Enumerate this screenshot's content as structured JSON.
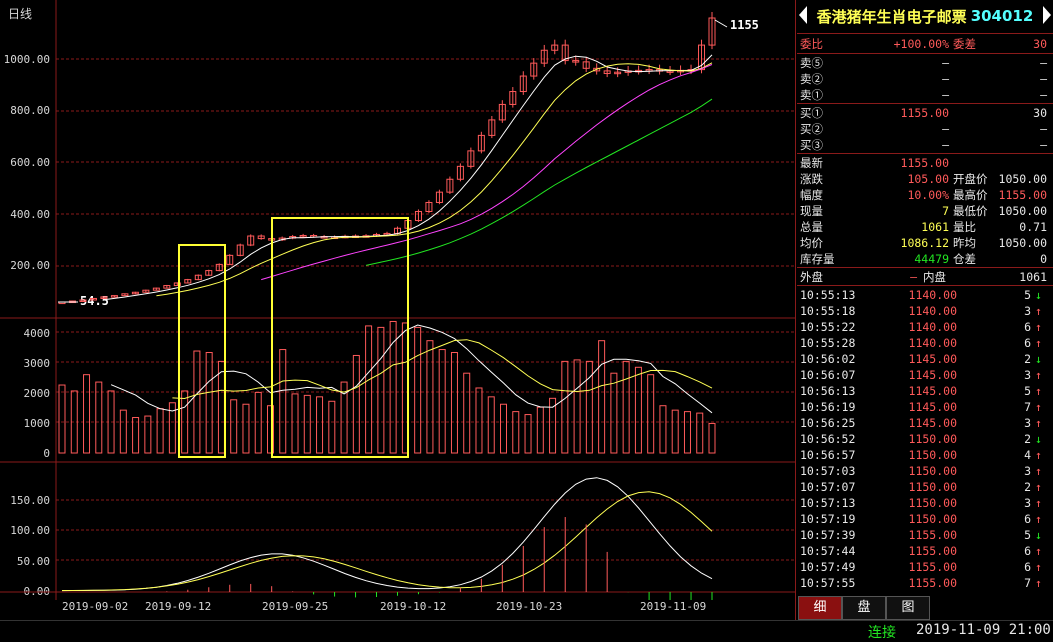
{
  "chart": {
    "period_label": "日线",
    "price_ticks": [
      "1000.00",
      "800.00",
      "600.00",
      "400.00",
      "200.00"
    ],
    "volume_ticks": [
      "4000",
      "3000",
      "2000",
      "1000",
      "0"
    ],
    "indicator_ticks": [
      "150.00",
      "100.00",
      "50.00",
      "0.00"
    ],
    "date_ticks": [
      "2019-09-02",
      "2019-09-12",
      "2019-09-25",
      "2019-10-12",
      "2019-10-23",
      "2019-11-09"
    ],
    "high_label": "1155",
    "low_label": "54.5",
    "colors": {
      "up": "#ff5a5a",
      "ma1": "#ffffff",
      "ma2": "#ffff55",
      "ma3": "#ff44ff",
      "ma4": "#22e622",
      "box": "#ffff33",
      "grid": "#8a1a1a"
    }
  },
  "chart_data": {
    "type": "candlestick",
    "dates": [
      "2019-09-02",
      "2019-09-12",
      "2019-09-25",
      "2019-10-12",
      "2019-10-23",
      "2019-11-09"
    ],
    "close": [
      54,
      58,
      62,
      68,
      74,
      79,
      86,
      92,
      100,
      108,
      118,
      128,
      141,
      158,
      176,
      200,
      235,
      275,
      310,
      300,
      295,
      302,
      308,
      312,
      308,
      305,
      306,
      309,
      310,
      311,
      316,
      320,
      340,
      370,
      405,
      440,
      480,
      530,
      580,
      640,
      700,
      760,
      820,
      870,
      930,
      980,
      1030,
      1050,
      990,
      985,
      960,
      950,
      940,
      945,
      950,
      952,
      955,
      950,
      948,
      952,
      955,
      1050,
      1155
    ],
    "volume": [
      2300,
      2100,
      2650,
      2400,
      2100,
      1450,
      1200,
      1250,
      1500,
      1700,
      2100,
      3450,
      3400,
      3100,
      1800,
      1650,
      2050,
      1600,
      3500,
      2000,
      1950,
      1900,
      1750,
      2400,
      3300,
      4300,
      4250,
      4450,
      4400,
      4250,
      3800,
      3500,
      3400,
      2700,
      2200,
      1900,
      1650,
      1400,
      1300,
      1550,
      1850,
      3100,
      3150,
      3100,
      3800,
      2700,
      3100,
      2900,
      2650,
      1600,
      1450,
      1400,
      1350,
      1000
    ],
    "ylim_price": [
      0,
      1155
    ],
    "ylim_volume": [
      0,
      4500
    ],
    "ylim_indicator": [
      0,
      170
    ]
  },
  "quote": {
    "name": "香港猪年生肖电子邮票",
    "code": "304012",
    "weibi_label": "委比",
    "weibi_val": "+100.00%",
    "weicha_label": "委差",
    "weicha_val": "30",
    "sell": [
      {
        "label": "卖⑤",
        "price": "—",
        "vol": "—"
      },
      {
        "label": "卖②",
        "price": "—",
        "vol": "—"
      },
      {
        "label": "卖①",
        "price": "—",
        "vol": "—"
      }
    ],
    "buy": [
      {
        "label": "买①",
        "price": "1155.00",
        "vol": "30"
      },
      {
        "label": "买②",
        "price": "—",
        "vol": "—"
      },
      {
        "label": "买③",
        "price": "—",
        "vol": "—"
      }
    ],
    "stats": [
      {
        "l1": "最新",
        "v1": "1155.00",
        "l2": "",
        "v2": ""
      },
      {
        "l1": "涨跌",
        "v1": "105.00",
        "l2": "开盘价",
        "v2": "1050.00"
      },
      {
        "l1": "幅度",
        "v1": "10.00%",
        "l2": "最高价",
        "v2": "1155.00"
      },
      {
        "l1": "现量",
        "v1": "7",
        "l2": "最低价",
        "v2": "1050.00"
      },
      {
        "l1": "总量",
        "v1": "1061",
        "l2": "量比",
        "v2": "0.71"
      },
      {
        "l1": "均价",
        "v1": "1086.12",
        "l2": "昨均",
        "v2": "1050.00"
      },
      {
        "l1": "库存量",
        "v1": "44479",
        "l2": "仓差",
        "v2": "0"
      }
    ],
    "waipan_label": "外盘",
    "waipan_val": "—",
    "neipan_label": "内盘",
    "neipan_val": "1061"
  },
  "ticks": [
    {
      "time": "10:55:13",
      "price": "1140.00",
      "vol": "5",
      "dir": "down"
    },
    {
      "time": "10:55:18",
      "price": "1140.00",
      "vol": "3",
      "dir": "up"
    },
    {
      "time": "10:55:22",
      "price": "1140.00",
      "vol": "6",
      "dir": "up"
    },
    {
      "time": "10:55:28",
      "price": "1140.00",
      "vol": "6",
      "dir": "up"
    },
    {
      "time": "10:56:02",
      "price": "1145.00",
      "vol": "2",
      "dir": "down"
    },
    {
      "time": "10:56:07",
      "price": "1145.00",
      "vol": "3",
      "dir": "up"
    },
    {
      "time": "10:56:13",
      "price": "1145.00",
      "vol": "5",
      "dir": "up"
    },
    {
      "time": "10:56:19",
      "price": "1145.00",
      "vol": "7",
      "dir": "up"
    },
    {
      "time": "10:56:25",
      "price": "1145.00",
      "vol": "3",
      "dir": "up"
    },
    {
      "time": "10:56:52",
      "price": "1150.00",
      "vol": "2",
      "dir": "down"
    },
    {
      "time": "10:56:57",
      "price": "1150.00",
      "vol": "4",
      "dir": "up"
    },
    {
      "time": "10:57:03",
      "price": "1150.00",
      "vol": "3",
      "dir": "up"
    },
    {
      "time": "10:57:07",
      "price": "1150.00",
      "vol": "2",
      "dir": "up"
    },
    {
      "time": "10:57:13",
      "price": "1150.00",
      "vol": "3",
      "dir": "up"
    },
    {
      "time": "10:57:19",
      "price": "1150.00",
      "vol": "6",
      "dir": "up"
    },
    {
      "time": "10:57:39",
      "price": "1155.00",
      "vol": "5",
      "dir": "down"
    },
    {
      "time": "10:57:44",
      "price": "1155.00",
      "vol": "6",
      "dir": "up"
    },
    {
      "time": "10:57:49",
      "price": "1155.00",
      "vol": "6",
      "dir": "up"
    },
    {
      "time": "10:57:55",
      "price": "1155.00",
      "vol": "7",
      "dir": "up"
    }
  ],
  "tabs": [
    "细",
    "盘",
    "图"
  ],
  "status": {
    "connection": "连接",
    "datetime": "2019-11-09 21:00"
  }
}
